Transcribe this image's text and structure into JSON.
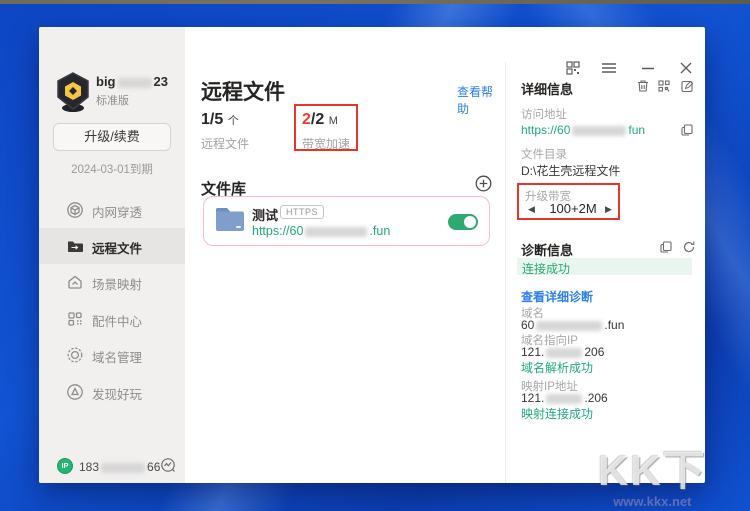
{
  "sidebar": {
    "user": {
      "name_prefix": "big",
      "name_suffix": "23",
      "plan": "标准版"
    },
    "upgrade_button": "升级/续费",
    "expiry": "2024-03-01到期",
    "menu": [
      {
        "label": "内网穿透"
      },
      {
        "label": "远程文件"
      },
      {
        "label": "场景映射"
      },
      {
        "label": "配件中心"
      },
      {
        "label": "域名管理"
      },
      {
        "label": "发现好玩"
      }
    ],
    "footer": {
      "badge": "IP",
      "ip_prefix": "183",
      "ip_suffix": "66"
    }
  },
  "main": {
    "title": "远程文件",
    "help_link": "查看帮助",
    "stats": {
      "files": {
        "value": "1/5",
        "unit": "个",
        "label": "远程文件"
      },
      "bandwidth": {
        "used": "2",
        "total": "/2",
        "unit": "M",
        "label": "带宽加速"
      }
    },
    "library_heading": "文件库",
    "file_card": {
      "name": "测试",
      "protocol_badge": "HTTPS",
      "url_prefix": "https://60",
      "url_suffix": ".fun"
    }
  },
  "detail_panel": {
    "title": "详细信息",
    "address_label": "访问地址",
    "address_prefix": "https://60",
    "address_suffix": "fun",
    "directory_label": "文件目录",
    "directory_value": "D:\\花生壳远程文件",
    "bandwidth_label": "升级带宽",
    "bandwidth_value": "100+2M",
    "stepper_prev": "◀",
    "stepper_next": "▶"
  },
  "diagnosis_panel": {
    "title": "诊断信息",
    "status": "连接成功",
    "detail_link": "查看详细诊断",
    "domain_label": "域名",
    "domain_prefix": "60",
    "domain_suffix": ".fun",
    "dns_ip_label": "域名指向IP",
    "dns_ip_prefix": "121.",
    "dns_ip_suffix": "206",
    "dns_result": "域名解析成功",
    "map_ip_label": "映射IP地址",
    "map_ip_prefix": "121.",
    "map_ip_suffix": ".206",
    "map_result": "映射连接成功"
  },
  "watermark": {
    "text": "KK下",
    "url": "www.kkx.net"
  },
  "colors": {
    "green": "#21ab77",
    "blue": "#2e7fe8",
    "red": "#e8352c",
    "toggle": "#2fa972"
  }
}
